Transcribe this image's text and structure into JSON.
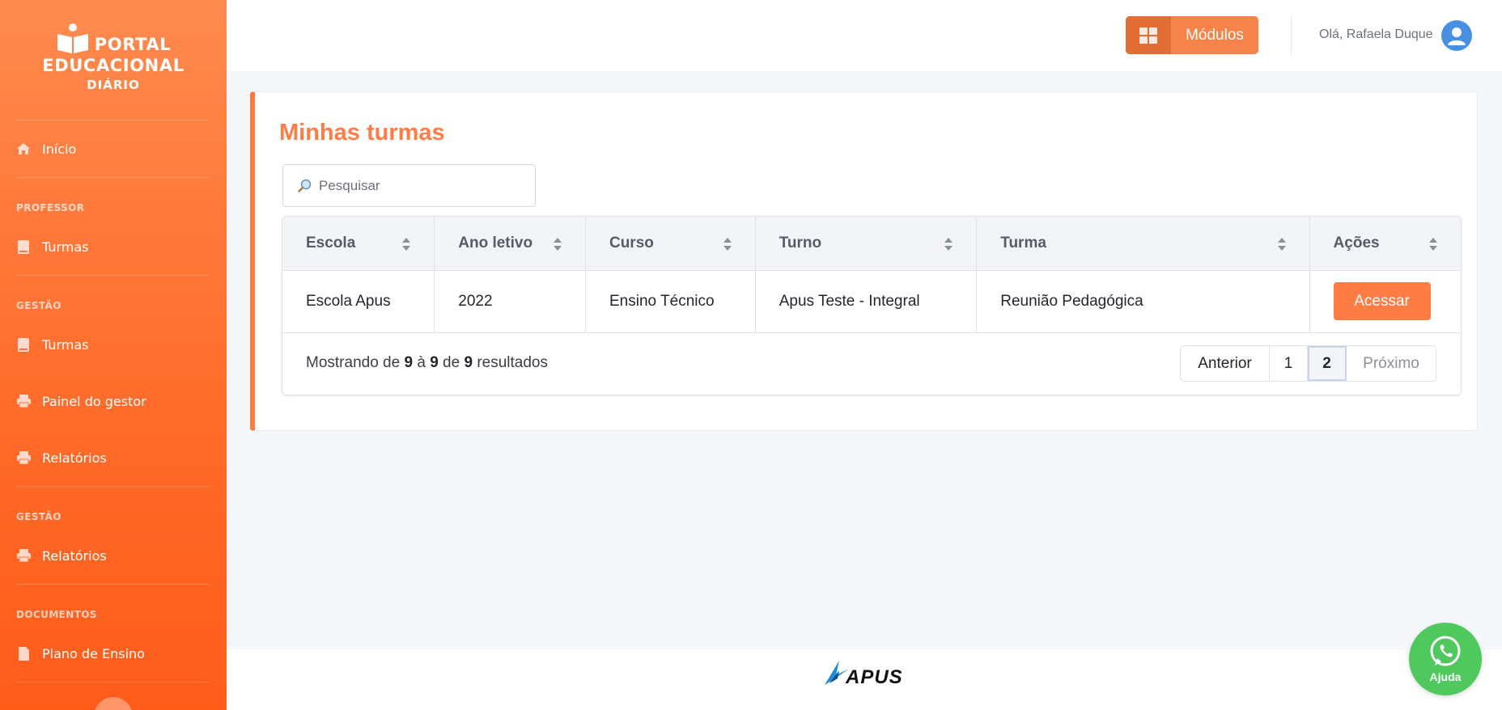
{
  "sidebar": {
    "logo": {
      "line1": "PORTAL",
      "line2": "EDUCACIONAL",
      "line3": "DIÁRIO"
    },
    "home": {
      "label": "Início",
      "icon": "home-icon"
    },
    "sections": [
      {
        "title": "PROFESSOR",
        "items": [
          {
            "label": "Turmas",
            "icon": "book-icon"
          }
        ]
      },
      {
        "title": "GESTÃO",
        "items": [
          {
            "label": "Turmas",
            "icon": "book-icon"
          },
          {
            "label": "Painel do gestor",
            "icon": "print-icon"
          },
          {
            "label": "Relatórios",
            "icon": "print-icon"
          }
        ]
      },
      {
        "title": "GESTÃO",
        "items": [
          {
            "label": "Relatórios",
            "icon": "print-icon"
          }
        ]
      },
      {
        "title": "DOCUMENTOS",
        "items": [
          {
            "label": "Plano de Ensino",
            "icon": "document-icon"
          }
        ]
      }
    ]
  },
  "header": {
    "modules_label": "Módulos",
    "greeting": "Olá, Rafaela Duque"
  },
  "main": {
    "title": "Minhas turmas",
    "search_placeholder": "Pesquisar",
    "table": {
      "columns": [
        "Escola",
        "Ano letivo",
        "Curso",
        "Turno",
        "Turma",
        "Ações"
      ],
      "rows": [
        {
          "escola": "Escola Apus",
          "ano": "2022",
          "curso": "Ensino Técnico",
          "turno": "Apus Teste - Integral",
          "turma": "Reunião Pedagógica",
          "action": "Acessar"
        }
      ]
    },
    "summary": {
      "prefix": "Mostrando de",
      "from": "9",
      "sep1": "à",
      "to": "9",
      "sep2": "de",
      "total": "9",
      "suffix": "resultados"
    },
    "pagination": {
      "prev": "Anterior",
      "pages": [
        "1",
        "2"
      ],
      "current": "2",
      "next": "Próximo"
    }
  },
  "footer": {
    "brand": "APUS"
  },
  "help": {
    "label": "Ajuda"
  },
  "colors": {
    "accent": "#ff7d45",
    "sidebar_top": "#ff8a4f",
    "sidebar_bottom": "#ff5c1a",
    "help": "#4fc95e",
    "avatar": "#4a90e2"
  }
}
